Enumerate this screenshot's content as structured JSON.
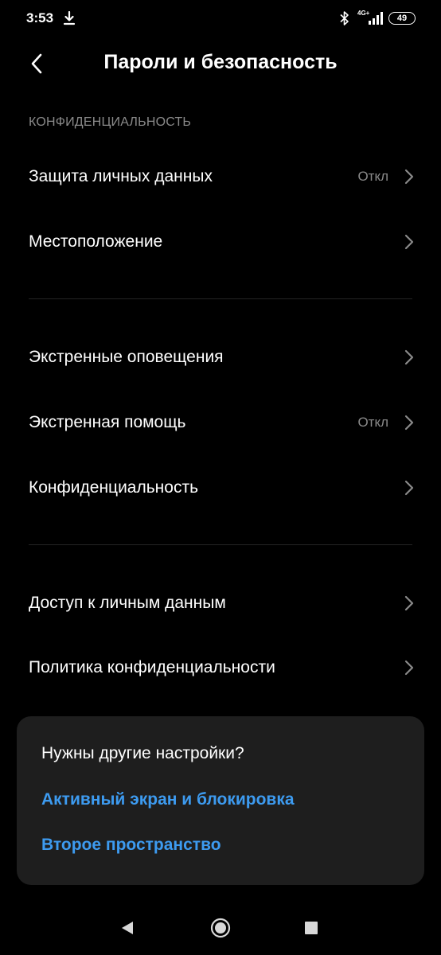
{
  "status_bar": {
    "time": "3:53",
    "network": "4G+",
    "battery": "49"
  },
  "header": {
    "title": "Пароли и безопасность"
  },
  "section": {
    "privacy_header": "КОНФИДЕНЦИАЛЬНОСТЬ"
  },
  "rows": [
    {
      "label": "Защита личных данных",
      "value": "Откл"
    },
    {
      "label": "Местоположение",
      "value": ""
    },
    {
      "label": "Экстренные оповещения",
      "value": ""
    },
    {
      "label": "Экстренная помощь",
      "value": "Откл"
    },
    {
      "label": "Конфиденциальность",
      "value": ""
    },
    {
      "label": "Доступ к личным данным",
      "value": ""
    },
    {
      "label": "Политика конфиденциальности",
      "value": ""
    }
  ],
  "card": {
    "title": "Нужны другие настройки?",
    "links": [
      "Активный экран и блокировка",
      "Второе пространство"
    ]
  },
  "colors": {
    "background": "#000000",
    "text": "#ffffff",
    "secondary_text": "#8a8a8a",
    "link": "#3d9bf0",
    "card_background": "#1e1e1e"
  }
}
